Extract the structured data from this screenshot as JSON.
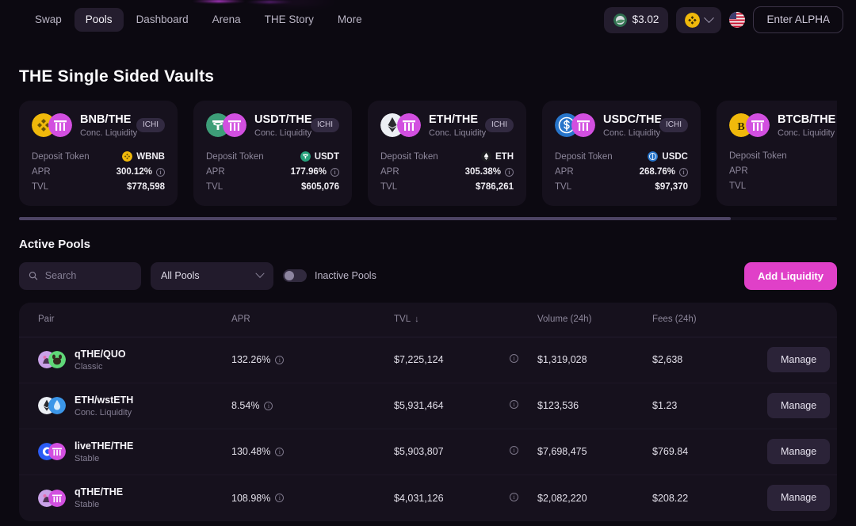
{
  "nav": {
    "items": [
      {
        "label": "Swap",
        "active": false
      },
      {
        "label": "Pools",
        "active": true
      },
      {
        "label": "Dashboard",
        "active": false
      },
      {
        "label": "Arena",
        "active": false
      },
      {
        "label": "THE Story",
        "active": false
      },
      {
        "label": "More",
        "active": false
      }
    ]
  },
  "header": {
    "price": "$3.02",
    "price_icon": "the-token-icon",
    "chain_icon": "bnb-chain-icon",
    "chain_chevron_icon": "chevron-down-icon",
    "language_icon": "us-flag-icon",
    "connect_label": "Enter ALPHA"
  },
  "vaults": {
    "title": "THE Single Sided Vaults",
    "labels": {
      "deposit_token": "Deposit Token",
      "apr": "APR",
      "tvl": "TVL"
    },
    "cards": [
      {
        "pair": "BNB/THE",
        "subtitle": "Conc. Liquidity",
        "badge": "ICHI",
        "deposit_token": "WBNB",
        "apr": "300.12%",
        "tvl": "$778,598",
        "icon_a": "bnb-icon",
        "icon_b": "the-icon",
        "deposit_icon": "wbnb-icon"
      },
      {
        "pair": "USDT/THE",
        "subtitle": "Conc. Liquidity",
        "badge": "ICHI",
        "deposit_token": "USDT",
        "apr": "177.96%",
        "tvl": "$605,076",
        "icon_a": "usdt-icon",
        "icon_b": "the-icon",
        "deposit_icon": "usdt-icon"
      },
      {
        "pair": "ETH/THE",
        "subtitle": "Conc. Liquidity",
        "badge": "ICHI",
        "deposit_token": "ETH",
        "apr": "305.38%",
        "tvl": "$786,261",
        "icon_a": "eth-icon",
        "icon_b": "the-icon",
        "deposit_icon": "eth-icon"
      },
      {
        "pair": "USDC/THE",
        "subtitle": "Conc. Liquidity",
        "badge": "ICHI",
        "deposit_token": "USDC",
        "apr": "268.76%",
        "tvl": "$97,370",
        "icon_a": "usdc-icon",
        "icon_b": "the-icon",
        "deposit_icon": "usdc-icon"
      },
      {
        "pair": "BTCB/THE",
        "subtitle": "Conc. Liquidity",
        "badge": "",
        "deposit_token": "",
        "apr": "",
        "tvl": "",
        "icon_a": "btcb-icon",
        "icon_b": "the-icon",
        "deposit_icon": ""
      }
    ]
  },
  "pools": {
    "title": "Active Pools",
    "search_placeholder": "Search",
    "search_value": "",
    "filter_selected": "All Pools",
    "inactive_toggle_label": "Inactive Pools",
    "inactive_toggle_on": false,
    "add_liquidity_label": "Add Liquidity",
    "columns": [
      "Pair",
      "APR",
      "TVL",
      "Volume (24h)",
      "Fees (24h)"
    ],
    "sorted_column": "TVL",
    "sort_direction_icon": "arrow-down-icon",
    "manage_label": "Manage",
    "rows": [
      {
        "pair": "qTHE/QUO",
        "type": "Classic",
        "apr": "132.26%",
        "tvl": "$7,225,124",
        "volume": "$1,319,028",
        "fees": "$2,638",
        "icon_a": "qthe-icon",
        "icon_b": "quo-icon"
      },
      {
        "pair": "ETH/wstETH",
        "type": "Conc. Liquidity",
        "apr": "8.54%",
        "tvl": "$5,931,464",
        "volume": "$123,536",
        "fees": "$1.23",
        "icon_a": "eth-icon",
        "icon_b": "wsteth-icon"
      },
      {
        "pair": "liveTHE/THE",
        "type": "Stable",
        "apr": "130.48%",
        "tvl": "$5,903,807",
        "volume": "$7,698,475",
        "fees": "$769.84",
        "icon_a": "livethe-icon",
        "icon_b": "the-icon"
      },
      {
        "pair": "qTHE/THE",
        "type": "Stable",
        "apr": "108.98%",
        "tvl": "$4,031,126",
        "volume": "$2,082,220",
        "fees": "$208.22",
        "icon_a": "qthe-icon",
        "icon_b": "the-icon"
      }
    ]
  },
  "colors": {
    "background": "#0c0911",
    "card": "#16111d",
    "accent": "#e040c8",
    "nav_active": "#241d2e",
    "muted_text": "#8d879b"
  }
}
